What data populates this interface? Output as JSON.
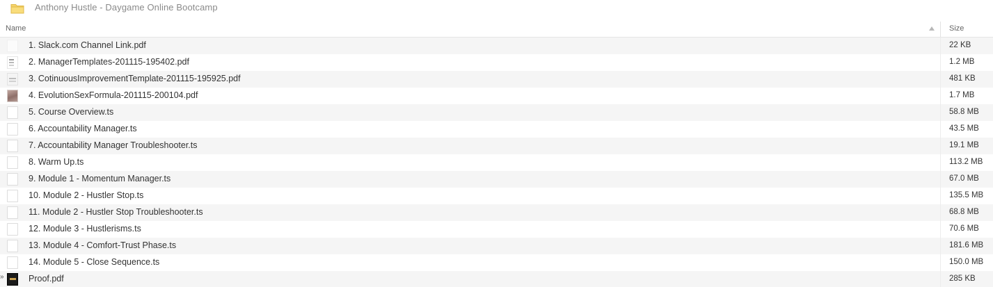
{
  "folder": {
    "title": "Anthony Hustle - Daygame Online Bootcamp",
    "icon": "folder-icon"
  },
  "columns": {
    "name": "Name",
    "size": "Size"
  },
  "files": [
    {
      "name": "1. Slack.com Channel Link.pdf",
      "size": "22 KB",
      "icon": "blank-thumbnail-icon"
    },
    {
      "name": "2. ManagerTemplates-201115-195402.pdf",
      "size": "1.2 MB",
      "icon": "document-thumbnail-icon"
    },
    {
      "name": "3. CotinuousImprovementTemplate-201115-195925.pdf",
      "size": "481 KB",
      "icon": "document-thumbnail-icon"
    },
    {
      "name": "4. EvolutionSexFormula-201115-200104.pdf",
      "size": "1.7 MB",
      "icon": "image-thumbnail-icon"
    },
    {
      "name": "5. Course Overview.ts",
      "size": "58.8 MB",
      "icon": "file-icon"
    },
    {
      "name": "6. Accountability Manager.ts",
      "size": "43.5 MB",
      "icon": "file-icon"
    },
    {
      "name": "7. Accountability Manager Troubleshooter.ts",
      "size": "19.1 MB",
      "icon": "file-icon"
    },
    {
      "name": "8. Warm Up.ts",
      "size": "113.2 MB",
      "icon": "file-icon"
    },
    {
      "name": "9. Module 1 - Momentum Manager.ts",
      "size": "67.0 MB",
      "icon": "file-icon"
    },
    {
      "name": "10. Module 2 - Hustler Stop.ts",
      "size": "135.5 MB",
      "icon": "file-icon"
    },
    {
      "name": "11. Module 2 - Hustler Stop Troubleshooter.ts",
      "size": "68.8 MB",
      "icon": "file-icon"
    },
    {
      "name": "12. Module 3 - Hustlerisms.ts",
      "size": "70.6 MB",
      "icon": "file-icon"
    },
    {
      "name": "13. Module 4 - Comfort-Trust Phase.ts",
      "size": "181.6 MB",
      "icon": "file-icon"
    },
    {
      "name": "14. Module 5 - Close Sequence.ts",
      "size": "150.0 MB",
      "icon": "file-icon"
    },
    {
      "name": "Proof.pdf",
      "size": "285 KB",
      "icon": "proof-thumbnail-icon"
    }
  ],
  "colors": {
    "folder": "#f2c94c",
    "row_alt": "#f5f5f5",
    "header_text": "#8a8a8a"
  }
}
